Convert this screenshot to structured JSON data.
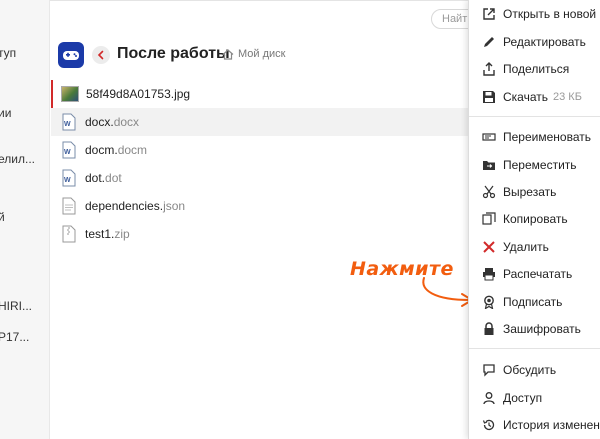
{
  "sidebar": {
    "items": [
      {
        "label": "туп"
      },
      {
        "label": "ии"
      },
      {
        "label": "елил..."
      },
      {
        "label": "й"
      },
      {
        "label": "HIRI..."
      },
      {
        "label": "P17..."
      }
    ]
  },
  "search": {
    "placeholder": "Найти"
  },
  "header": {
    "title": "После работы",
    "breadcrumb": "Мой диск"
  },
  "files": [
    {
      "name": "58f49d8A01753.jpg",
      "ext": ""
    },
    {
      "name": "docx.",
      "ext": "docx"
    },
    {
      "name": "docm.",
      "ext": "docm"
    },
    {
      "name": "dot.",
      "ext": "dot"
    },
    {
      "name": "dependencies.",
      "ext": "json"
    },
    {
      "name": "test1.",
      "ext": "zip"
    }
  ],
  "menu": {
    "open_new": "Открыть в новой в",
    "edit": "Редактировать",
    "share": "Поделиться",
    "download": "Скачать",
    "download_size": "23 КБ",
    "rename": "Переименовать",
    "move": "Переместить",
    "cut": "Вырезать",
    "copy": "Копировать",
    "delete": "Удалить",
    "print": "Распечатать",
    "sign": "Подписать",
    "encrypt": "Зашифровать",
    "discuss": "Обсудить",
    "access": "Доступ",
    "history": "История изменени"
  },
  "annotation": {
    "text": "Нажмите"
  },
  "colors": {
    "accent_red": "#d22a2a",
    "annotation_orange": "#f25d0f",
    "logo_blue": "#1b3aa8"
  }
}
